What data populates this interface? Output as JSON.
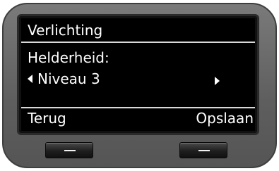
{
  "screen": {
    "title": "Verlichting",
    "setting_label": "Helderheid:",
    "value": "Niveau 3",
    "prev_icon": "triangle-left-icon",
    "next_icon": "triangle-right-icon"
  },
  "softkeys": {
    "left_label": "Terug",
    "right_label": "Opslaan"
  },
  "colors": {
    "display_bg": "#000000",
    "display_text": "#ffffff",
    "device_body": "#666666"
  }
}
